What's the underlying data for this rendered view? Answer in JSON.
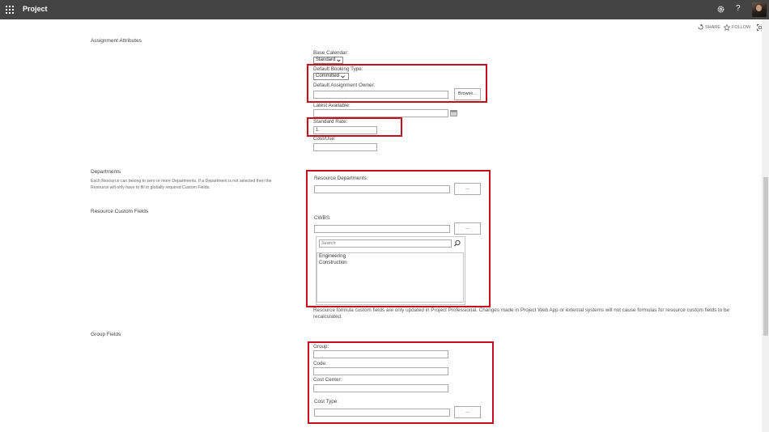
{
  "topbar": {
    "app_title": "Project",
    "help_glyph": "?",
    "icons": [
      "app-launcher-icon",
      "gear-icon",
      "help-icon",
      "avatar"
    ]
  },
  "actions": {
    "share": "SHARE",
    "follow": "FOLLOW"
  },
  "sections": {
    "assignment": "Assignment Attributes",
    "departments": "Departments",
    "departments_desc": "Each Resource can belong to zero or more Departments. If a Department is not selected then the Resource will only have to fill in globally required Custom Fields.",
    "custom_fields": "Resource Custom Fields",
    "group_fields": "Group Fields"
  },
  "assignment": {
    "base_calendar_label": "Base Calendar:",
    "base_calendar_value": "Standard",
    "booking_type_label": "Default Booking Type:",
    "booking_type_value": "Committed",
    "owner_label": "Default Assignment Owner:",
    "owner_value": "",
    "browse_button": "Browse...",
    "latest_available_label": "Latest Available:",
    "latest_available_value": "",
    "standard_rate_label": "Standard Rate:",
    "standard_rate_value": "1",
    "cost_use_label": "Cost/Use:",
    "cost_use_value": ""
  },
  "departments": {
    "resource_departments_label": "Resource Departments:",
    "resource_departments_value": "",
    "ellipsis_button": "..."
  },
  "custom": {
    "cwbs_label": "CWBS:",
    "cwbs_value": "",
    "ellipsis_button": "...",
    "search_placeholder": "Search",
    "items": [
      "Engineering",
      "Construction"
    ],
    "note": "Resource formula custom fields are only updated in Project Professional. Changes made in Project Web App or external systems will not cause formulas for resource custom fields to be recalculated."
  },
  "group": {
    "group_label": "Group:",
    "group_value": "",
    "code_label": "Code:",
    "code_value": "",
    "cost_center_label": "Cost Center:",
    "cost_center_value": "",
    "cost_type_label": "Cost Type:",
    "cost_type_value": "",
    "ellipsis_button": "..."
  },
  "colors": {
    "topbar": "#444444",
    "highlight": "#c50f1f"
  }
}
